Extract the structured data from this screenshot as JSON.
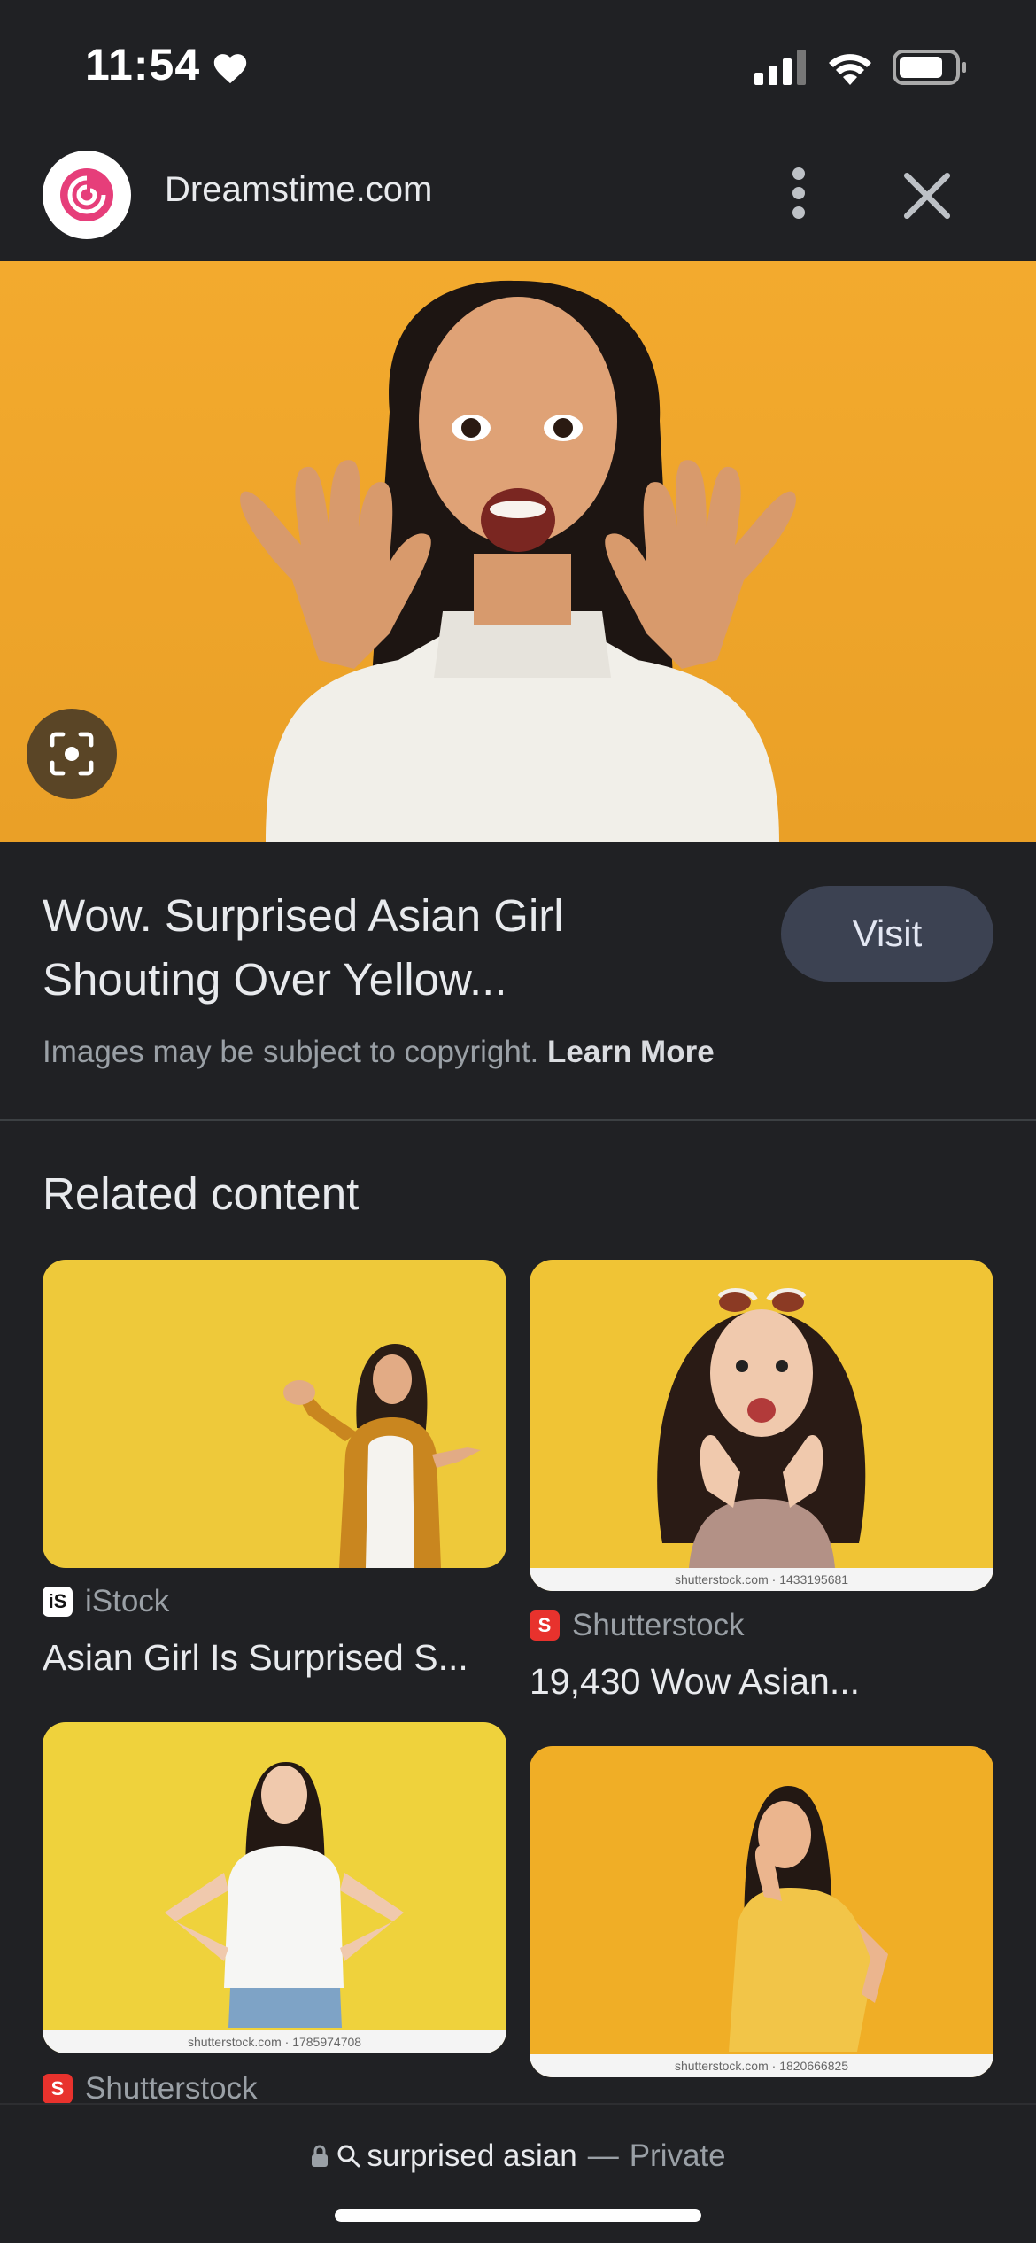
{
  "status_bar": {
    "time": "11:54"
  },
  "header": {
    "site_name": "Dreamstime.com",
    "logo_icon": "dreamstime-swirl-logo",
    "logo_color": "#e63e7a"
  },
  "hero": {
    "description_icon": "lens-search-icon",
    "background_color": "#f3aa2e"
  },
  "result": {
    "title_line1": "Wow. Surprised Asian Girl",
    "title_line2": "Shouting Over Yellow...",
    "visit_label": "Visit",
    "copyright_text": "Images may be subject to copyright.",
    "learn_more": "Learn More"
  },
  "related": {
    "heading": "Related content",
    "items": [
      {
        "source": "iStock",
        "title": "Asian Girl Is Surprised S...",
        "badge_text": "iS",
        "badge_color": "#ffffff",
        "bg_color": "#eec93a"
      },
      {
        "source": "Shutterstock",
        "title": "19,430 Wow Asian...",
        "watermark": "shutterstock.com · 1433195681",
        "badge_color": "#e8322d",
        "bg_color": "#f0c435"
      },
      {
        "source": "Shutterstock",
        "watermark": "shutterstock.com · 1785974708",
        "badge_color": "#e8322d",
        "bg_color": "#efd23c"
      },
      {
        "watermark": "shutterstock.com · 1820666825",
        "bg_color": "#f0ae26"
      }
    ]
  },
  "bottom_bar": {
    "query": "surprised asian",
    "separator": "—",
    "mode": "Private"
  }
}
